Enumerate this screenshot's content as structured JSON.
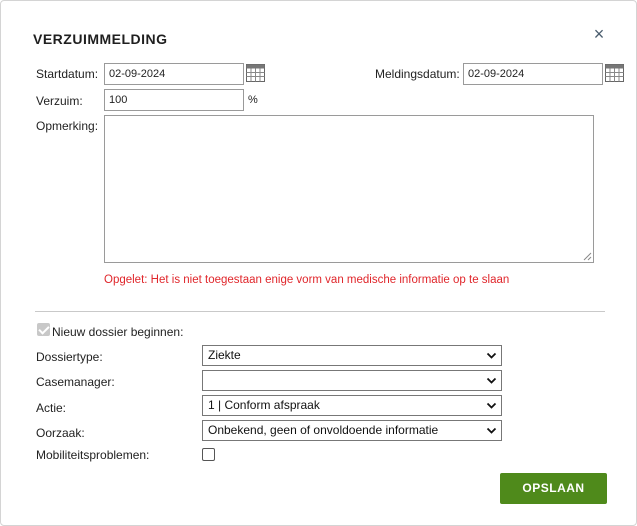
{
  "dialog": {
    "title": "VERZUIMMELDING",
    "close_symbol": "×"
  },
  "form": {
    "startdatum_label": "Startdatum:",
    "startdatum_value": "02-09-2024",
    "meldingsdatum_label": "Meldingsdatum:",
    "meldingsdatum_value": "02-09-2024",
    "verzuim_label": "Verzuim:",
    "verzuim_value": "100",
    "verzuim_unit": "%",
    "opmerking_label": "Opmerking:",
    "opmerking_value": "",
    "warning": "Opgelet: Het is niet toegestaan enige vorm van medische informatie op te slaan"
  },
  "dossier": {
    "new_dossier_label": "Nieuw dossier beginnen:",
    "new_dossier_checked": true,
    "dossiertype_label": "Dossiertype:",
    "dossiertype_value": "Ziekte",
    "casemanager_label": "Casemanager:",
    "casemanager_value": "",
    "actie_label": "Actie:",
    "actie_value": "1 | Conform afspraak",
    "oorzaak_label": "Oorzaak:",
    "oorzaak_value": "Onbekend, geen of onvoldoende informatie",
    "mobiliteit_label": "Mobiliteitsproblemen:",
    "mobiliteit_checked": false
  },
  "actions": {
    "save_label": "OPSLAAN"
  },
  "colors": {
    "accent_green": "#4f8a1b",
    "warning_red": "#e0262b"
  },
  "icons": {
    "calendar": "calendar-icon",
    "close": "close-icon",
    "chevron": "chevron-down-icon"
  }
}
